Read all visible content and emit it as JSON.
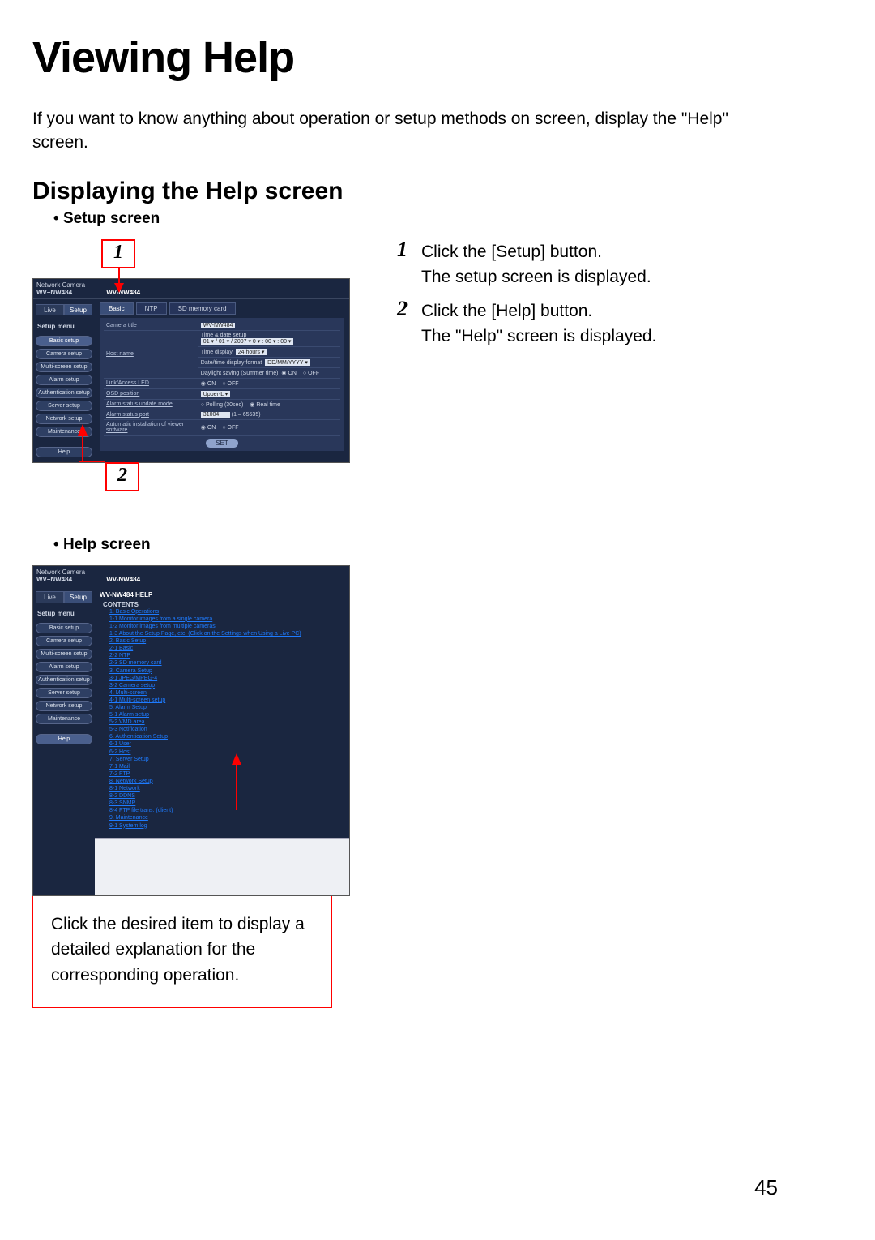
{
  "title": "Viewing Help",
  "intro": "If you want to know anything about operation or setup methods on screen, display the \"Help\" screen.",
  "section": "Displaying the Help screen",
  "bullets": {
    "setup": "Setup screen",
    "help": "Help screen"
  },
  "steps": {
    "s1": {
      "num": "1",
      "text1": "Click the [Setup] button.",
      "text2": "The setup screen is displayed."
    },
    "s2": {
      "num": "2",
      "text1": "Click the [Help] button.",
      "text2": "The \"Help\" screen is displayed."
    }
  },
  "callouts": {
    "c1": "1",
    "c2": "2"
  },
  "note": "Click the desired item to display a detailed explanation for the corresponding operation.",
  "page_number": "45",
  "app": {
    "brand_line1": "Network Camera",
    "brand_line2": "WV–NW484",
    "model": "WV-NW484",
    "tabs_live": {
      "live": "Live",
      "setup": "Setup"
    },
    "sidebar": {
      "head": "Setup menu",
      "items": [
        "Basic setup",
        "Camera setup",
        "Multi-screen setup",
        "Alarm setup",
        "Authentication setup",
        "Server setup",
        "Network setup",
        "Maintenance"
      ],
      "help": "Help"
    },
    "tabs2": {
      "basic": "Basic",
      "ntp": "NTP",
      "sd": "SD memory card"
    },
    "form": {
      "camera_title_lbl": "Camera title",
      "camera_title_val": "WV-NW484",
      "time_date_lbl": "Time & date setup",
      "time_date_val": "01 ▾ / 01 ▾ / 2007 ▾    0 ▾ : 00 ▾ : 00 ▾",
      "time_disp_lbl": "Time display",
      "time_disp_val": "24 hours ▾",
      "date_fmt_lbl": "Date/time display format",
      "date_fmt_val": "DD/MM/YYYY  ▾",
      "dst_lbl": "Daylight saving (Summer time)",
      "dst_on": "ON",
      "dst_off": "OFF",
      "led_lbl": "Link/Access LED",
      "led_on": "ON",
      "led_off": "OFF",
      "osd_lbl": "OSD position",
      "osd_val": "Upper-L  ▾",
      "alm_lbl": "Alarm status update mode",
      "alm_poll": "Polling (30sec)",
      "alm_real": "Real time",
      "port_lbl": "Alarm status port",
      "port_val1": "(1 – 65535)",
      "port_val0": "31004",
      "auto_lbl": "Automatic installation of viewer software",
      "auto_on": "ON",
      "auto_off": "OFF",
      "set": "SET"
    },
    "help_toc": {
      "head": "WV-NW484 HELP",
      "sub": "CONTENTS",
      "lines": [
        "1. Basic Operations",
        "1-1 Monitor images from a single camera",
        "1-2 Monitor images from multiple cameras",
        "1-3 About the Setup Page, etc. (Click on the Settings when Using a Live PC)",
        "2. Basic Setup",
        "2-1 Basic",
        "2-2 NTP",
        "2-3 SD memory card",
        "3. Camera Setup",
        "3-1 JPEG/MPEG-4",
        "3-2 Camera setup",
        "4. Multi-screen",
        "4-1 Multi-screen setup",
        "5. Alarm Setup",
        "5-1 Alarm setup",
        "5-2 VMD area",
        "5-3 Notification",
        "6. Authentication Setup",
        "6-1 User",
        "6-2 Host",
        "7. Server Setup",
        "7-1 Mail",
        "7-2 FTP",
        "8. Network Setup",
        "8-1 Network",
        "8-2 DDNS",
        "8-3 SNMP",
        "8-4 FTP file trans. (client)",
        "9. Maintenance",
        "9-1 System log"
      ]
    }
  }
}
